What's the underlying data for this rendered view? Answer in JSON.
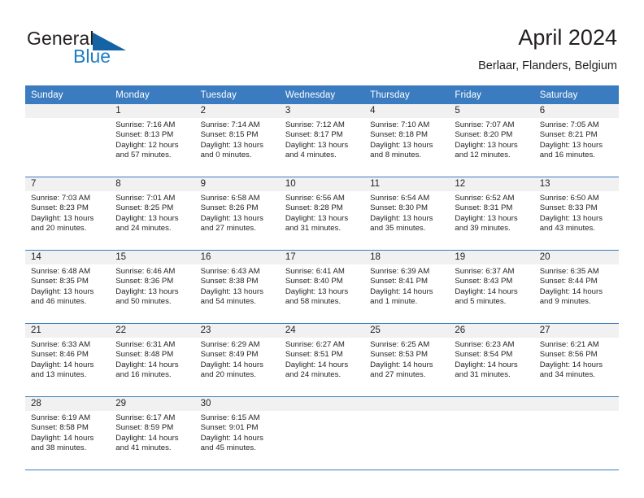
{
  "brand": {
    "line1": "General",
    "line2": "Blue",
    "mark": "triangle-logo-mark",
    "accent_blue": "#1f7dc4",
    "mark_color": "#1464a5"
  },
  "header": {
    "title": "April 2024",
    "subtitle": "Berlaar, Flanders, Belgium"
  },
  "theme": {
    "header_bg": "#3b7cc0",
    "header_text": "#ffffff",
    "daynum_band_bg": "#f1f1f1",
    "text": "#231f20",
    "rule": "#3b7cc0"
  },
  "calendar": {
    "weekday_headers": [
      "Sunday",
      "Monday",
      "Tuesday",
      "Wednesday",
      "Thursday",
      "Friday",
      "Saturday"
    ],
    "weeks": [
      [
        {
          "day": "",
          "sunrise": "",
          "sunset": "",
          "daylight_line1": "",
          "daylight_line2": ""
        },
        {
          "day": "1",
          "sunrise": "Sunrise: 7:16 AM",
          "sunset": "Sunset: 8:13 PM",
          "daylight_line1": "Daylight: 12 hours",
          "daylight_line2": "and 57 minutes."
        },
        {
          "day": "2",
          "sunrise": "Sunrise: 7:14 AM",
          "sunset": "Sunset: 8:15 PM",
          "daylight_line1": "Daylight: 13 hours",
          "daylight_line2": "and 0 minutes."
        },
        {
          "day": "3",
          "sunrise": "Sunrise: 7:12 AM",
          "sunset": "Sunset: 8:17 PM",
          "daylight_line1": "Daylight: 13 hours",
          "daylight_line2": "and 4 minutes."
        },
        {
          "day": "4",
          "sunrise": "Sunrise: 7:10 AM",
          "sunset": "Sunset: 8:18 PM",
          "daylight_line1": "Daylight: 13 hours",
          "daylight_line2": "and 8 minutes."
        },
        {
          "day": "5",
          "sunrise": "Sunrise: 7:07 AM",
          "sunset": "Sunset: 8:20 PM",
          "daylight_line1": "Daylight: 13 hours",
          "daylight_line2": "and 12 minutes."
        },
        {
          "day": "6",
          "sunrise": "Sunrise: 7:05 AM",
          "sunset": "Sunset: 8:21 PM",
          "daylight_line1": "Daylight: 13 hours",
          "daylight_line2": "and 16 minutes."
        }
      ],
      [
        {
          "day": "7",
          "sunrise": "Sunrise: 7:03 AM",
          "sunset": "Sunset: 8:23 PM",
          "daylight_line1": "Daylight: 13 hours",
          "daylight_line2": "and 20 minutes."
        },
        {
          "day": "8",
          "sunrise": "Sunrise: 7:01 AM",
          "sunset": "Sunset: 8:25 PM",
          "daylight_line1": "Daylight: 13 hours",
          "daylight_line2": "and 24 minutes."
        },
        {
          "day": "9",
          "sunrise": "Sunrise: 6:58 AM",
          "sunset": "Sunset: 8:26 PM",
          "daylight_line1": "Daylight: 13 hours",
          "daylight_line2": "and 27 minutes."
        },
        {
          "day": "10",
          "sunrise": "Sunrise: 6:56 AM",
          "sunset": "Sunset: 8:28 PM",
          "daylight_line1": "Daylight: 13 hours",
          "daylight_line2": "and 31 minutes."
        },
        {
          "day": "11",
          "sunrise": "Sunrise: 6:54 AM",
          "sunset": "Sunset: 8:30 PM",
          "daylight_line1": "Daylight: 13 hours",
          "daylight_line2": "and 35 minutes."
        },
        {
          "day": "12",
          "sunrise": "Sunrise: 6:52 AM",
          "sunset": "Sunset: 8:31 PM",
          "daylight_line1": "Daylight: 13 hours",
          "daylight_line2": "and 39 minutes."
        },
        {
          "day": "13",
          "sunrise": "Sunrise: 6:50 AM",
          "sunset": "Sunset: 8:33 PM",
          "daylight_line1": "Daylight: 13 hours",
          "daylight_line2": "and 43 minutes."
        }
      ],
      [
        {
          "day": "14",
          "sunrise": "Sunrise: 6:48 AM",
          "sunset": "Sunset: 8:35 PM",
          "daylight_line1": "Daylight: 13 hours",
          "daylight_line2": "and 46 minutes."
        },
        {
          "day": "15",
          "sunrise": "Sunrise: 6:46 AM",
          "sunset": "Sunset: 8:36 PM",
          "daylight_line1": "Daylight: 13 hours",
          "daylight_line2": "and 50 minutes."
        },
        {
          "day": "16",
          "sunrise": "Sunrise: 6:43 AM",
          "sunset": "Sunset: 8:38 PM",
          "daylight_line1": "Daylight: 13 hours",
          "daylight_line2": "and 54 minutes."
        },
        {
          "day": "17",
          "sunrise": "Sunrise: 6:41 AM",
          "sunset": "Sunset: 8:40 PM",
          "daylight_line1": "Daylight: 13 hours",
          "daylight_line2": "and 58 minutes."
        },
        {
          "day": "18",
          "sunrise": "Sunrise: 6:39 AM",
          "sunset": "Sunset: 8:41 PM",
          "daylight_line1": "Daylight: 14 hours",
          "daylight_line2": "and 1 minute."
        },
        {
          "day": "19",
          "sunrise": "Sunrise: 6:37 AM",
          "sunset": "Sunset: 8:43 PM",
          "daylight_line1": "Daylight: 14 hours",
          "daylight_line2": "and 5 minutes."
        },
        {
          "day": "20",
          "sunrise": "Sunrise: 6:35 AM",
          "sunset": "Sunset: 8:44 PM",
          "daylight_line1": "Daylight: 14 hours",
          "daylight_line2": "and 9 minutes."
        }
      ],
      [
        {
          "day": "21",
          "sunrise": "Sunrise: 6:33 AM",
          "sunset": "Sunset: 8:46 PM",
          "daylight_line1": "Daylight: 14 hours",
          "daylight_line2": "and 13 minutes."
        },
        {
          "day": "22",
          "sunrise": "Sunrise: 6:31 AM",
          "sunset": "Sunset: 8:48 PM",
          "daylight_line1": "Daylight: 14 hours",
          "daylight_line2": "and 16 minutes."
        },
        {
          "day": "23",
          "sunrise": "Sunrise: 6:29 AM",
          "sunset": "Sunset: 8:49 PM",
          "daylight_line1": "Daylight: 14 hours",
          "daylight_line2": "and 20 minutes."
        },
        {
          "day": "24",
          "sunrise": "Sunrise: 6:27 AM",
          "sunset": "Sunset: 8:51 PM",
          "daylight_line1": "Daylight: 14 hours",
          "daylight_line2": "and 24 minutes."
        },
        {
          "day": "25",
          "sunrise": "Sunrise: 6:25 AM",
          "sunset": "Sunset: 8:53 PM",
          "daylight_line1": "Daylight: 14 hours",
          "daylight_line2": "and 27 minutes."
        },
        {
          "day": "26",
          "sunrise": "Sunrise: 6:23 AM",
          "sunset": "Sunset: 8:54 PM",
          "daylight_line1": "Daylight: 14 hours",
          "daylight_line2": "and 31 minutes."
        },
        {
          "day": "27",
          "sunrise": "Sunrise: 6:21 AM",
          "sunset": "Sunset: 8:56 PM",
          "daylight_line1": "Daylight: 14 hours",
          "daylight_line2": "and 34 minutes."
        }
      ],
      [
        {
          "day": "28",
          "sunrise": "Sunrise: 6:19 AM",
          "sunset": "Sunset: 8:58 PM",
          "daylight_line1": "Daylight: 14 hours",
          "daylight_line2": "and 38 minutes."
        },
        {
          "day": "29",
          "sunrise": "Sunrise: 6:17 AM",
          "sunset": "Sunset: 8:59 PM",
          "daylight_line1": "Daylight: 14 hours",
          "daylight_line2": "and 41 minutes."
        },
        {
          "day": "30",
          "sunrise": "Sunrise: 6:15 AM",
          "sunset": "Sunset: 9:01 PM",
          "daylight_line1": "Daylight: 14 hours",
          "daylight_line2": "and 45 minutes."
        },
        {
          "day": "",
          "sunrise": "",
          "sunset": "",
          "daylight_line1": "",
          "daylight_line2": ""
        },
        {
          "day": "",
          "sunrise": "",
          "sunset": "",
          "daylight_line1": "",
          "daylight_line2": ""
        },
        {
          "day": "",
          "sunrise": "",
          "sunset": "",
          "daylight_line1": "",
          "daylight_line2": ""
        },
        {
          "day": "",
          "sunrise": "",
          "sunset": "",
          "daylight_line1": "",
          "daylight_line2": ""
        }
      ]
    ]
  }
}
